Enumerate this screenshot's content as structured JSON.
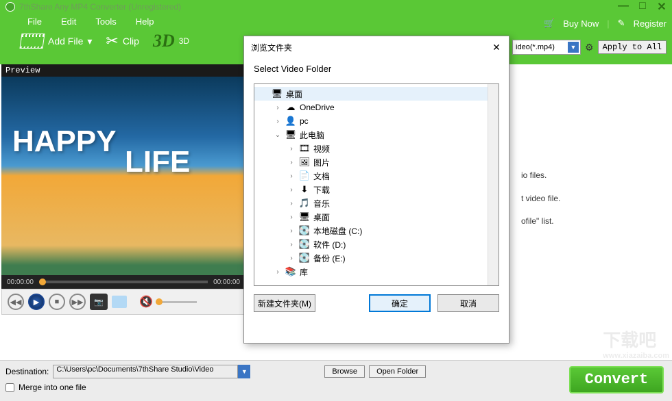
{
  "app": {
    "title": "7thShare Any MP4 Converter (Unregistered)"
  },
  "menubar": {
    "file": "File",
    "edit": "Edit",
    "tools": "Tools",
    "help": "Help"
  },
  "top_right": {
    "buy": "Buy Now",
    "register": "Register"
  },
  "toolbar": {
    "add_file": "Add File",
    "clip": "Clip",
    "d3": "3D",
    "d3_small": "3D"
  },
  "profile": {
    "value": "ideo(*.mp4)",
    "apply": "Apply to All"
  },
  "preview": {
    "label": "Preview",
    "t_start": "00:00:00",
    "t_end": "00:00:00",
    "happy": "HAPPY",
    "life": "LIFE"
  },
  "hints": {
    "h1": "io files.",
    "h2": "t video file.",
    "h3": "ofile\" list."
  },
  "bottom": {
    "dest_label": "Destination:",
    "dest_path": "C:\\Users\\pc\\Documents\\7thShare Studio\\Video",
    "browse": "Browse",
    "open_folder": "Open Folder",
    "merge": "Merge into one file",
    "convert": "Convert"
  },
  "dialog": {
    "title": "浏览文件夹",
    "subtitle": "Select Video Folder",
    "new_folder": "新建文件夹(M)",
    "ok": "确定",
    "cancel": "取消",
    "tree": [
      {
        "indent": 0,
        "exp": "",
        "ico": "🖥",
        "label": "桌面",
        "sel": true,
        "icon_name": "desktop-icon"
      },
      {
        "indent": 1,
        "exp": "›",
        "ico": "☁",
        "label": "OneDrive",
        "icon_name": "onedrive-icon"
      },
      {
        "indent": 1,
        "exp": "›",
        "ico": "👤",
        "label": "pc",
        "icon_name": "user-icon"
      },
      {
        "indent": 1,
        "exp": "⌄",
        "ico": "🖥",
        "label": "此电脑",
        "icon_name": "computer-icon"
      },
      {
        "indent": 2,
        "exp": "›",
        "ico": "🎞",
        "label": "视频",
        "icon_name": "videos-icon"
      },
      {
        "indent": 2,
        "exp": "›",
        "ico": "🖼",
        "label": "图片",
        "icon_name": "pictures-icon"
      },
      {
        "indent": 2,
        "exp": "›",
        "ico": "📄",
        "label": "文档",
        "icon_name": "documents-icon"
      },
      {
        "indent": 2,
        "exp": "›",
        "ico": "⬇",
        "label": "下载",
        "icon_name": "downloads-icon"
      },
      {
        "indent": 2,
        "exp": "›",
        "ico": "🎵",
        "label": "音乐",
        "icon_name": "music-icon"
      },
      {
        "indent": 2,
        "exp": "›",
        "ico": "🖥",
        "label": "桌面",
        "icon_name": "desktop-folder-icon"
      },
      {
        "indent": 2,
        "exp": "›",
        "ico": "💽",
        "label": "本地磁盘 (C:)",
        "icon_name": "disk-icon"
      },
      {
        "indent": 2,
        "exp": "›",
        "ico": "💽",
        "label": "软件 (D:)",
        "icon_name": "disk-icon"
      },
      {
        "indent": 2,
        "exp": "›",
        "ico": "💽",
        "label": "备份 (E:)",
        "icon_name": "disk-icon"
      },
      {
        "indent": 1,
        "exp": "›",
        "ico": "📚",
        "label": "库",
        "icon_name": "libraries-icon"
      }
    ]
  },
  "watermark": {
    "big": "下载吧",
    "small": "www.xiazaiba.com"
  }
}
